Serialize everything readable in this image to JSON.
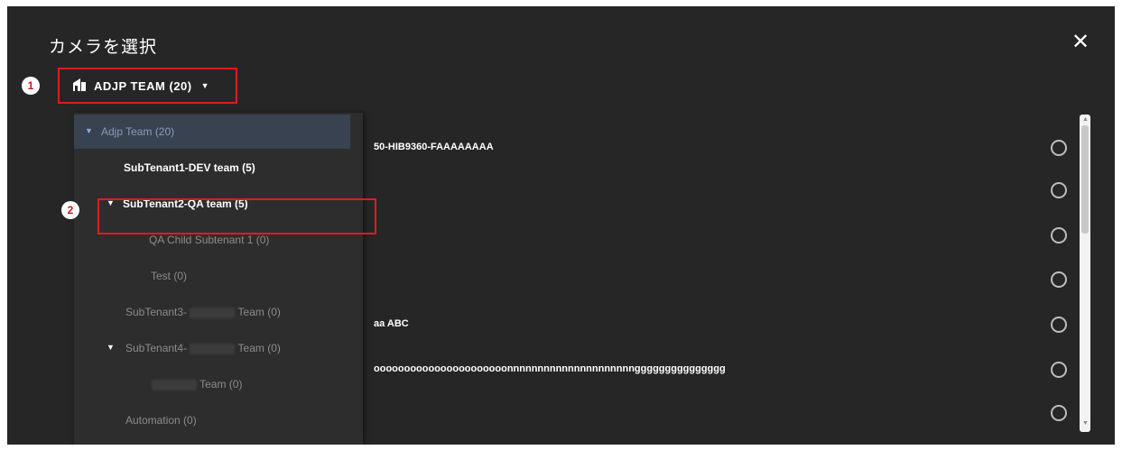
{
  "dialog": {
    "title": "カメラを選択",
    "close_glyph": "✕"
  },
  "tenant_selector": {
    "label": "ADJP TEAM (20)",
    "caret": "▼"
  },
  "badges": [
    "1",
    "2"
  ],
  "tree": {
    "items": [
      {
        "label": "Adjp Team (20)",
        "arrow": "▼"
      },
      {
        "label": "SubTenant1-DEV team (5)"
      },
      {
        "label": "SubTenant2-QA team (5)",
        "arrow": "▼"
      },
      {
        "label": "QA Child Subtenant 1 (0)"
      },
      {
        "label": "Test (0)"
      },
      {
        "label_prefix": "SubTenant3-",
        "label_suffix": "Team (0)"
      },
      {
        "label_prefix": "SubTenant4-",
        "label_suffix": "Team (0)",
        "arrow": "▼"
      },
      {
        "label_suffix": "Team (0)"
      },
      {
        "label": "Automation (0)"
      }
    ]
  },
  "camera_list": {
    "rows": [
      {
        "text": "50-HIB9360-FAAAAAAAA"
      },
      {
        "text": ""
      },
      {
        "text": ""
      },
      {
        "text": ""
      },
      {
        "text": "aa   ABC"
      },
      {
        "text": "oooooooooooooooooooooonnnnnnnnnnnnnnnnnnnnnggggggggggggggg"
      },
      {
        "text": ""
      }
    ]
  },
  "colors": {
    "modal_bg": "#262626",
    "tree_bg": "#2d2d2d",
    "selected_bg": "#394250",
    "highlight_red": "#e11b1b"
  }
}
